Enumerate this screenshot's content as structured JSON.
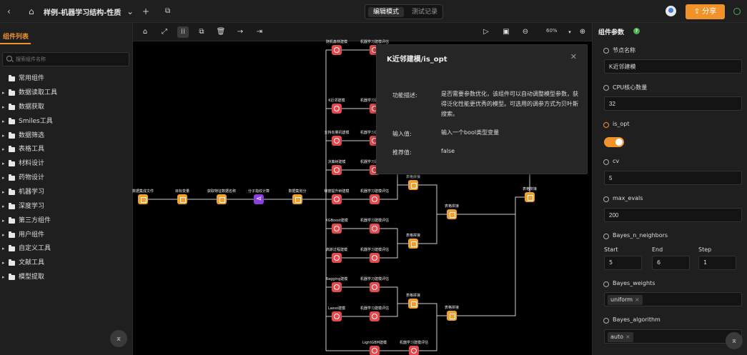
{
  "topbar": {
    "title": "样例-机器学习结构-性质",
    "mode_edit": "编辑模式",
    "mode_test": "测试记录",
    "share": "分享",
    "back_icon": "chevron-left-icon",
    "home_icon": "home-icon",
    "add_icon": "plus-icon",
    "copy_icon": "copy-icon"
  },
  "left": {
    "title": "组件列表",
    "search_placeholder": "搜索组件名称",
    "categories": [
      "常用组件",
      "数据读取工具",
      "数据获取",
      "Smiles工具",
      "数据筛选",
      "表格工具",
      "材料设计",
      "药物设计",
      "机器学习",
      "深度学习",
      "第三方组件",
      "用户组件",
      "自定义工具",
      "文献工具",
      "模型提取"
    ]
  },
  "canvas": {
    "zoom": "60%",
    "nodes": [
      "数据集成文件",
      "目标变量",
      "获取特征数据名称",
      "分子指纹计算",
      "数据集划分",
      "随机森林建模",
      "机器学习建模评估",
      "K近邻建模",
      "机器学习建模评估",
      "支持向量机建模",
      "机器学习建模评估",
      "决策树建模",
      "机器学习建模评估",
      "梯度提升树建模",
      "机器学习建模评估",
      "XGBoost建模",
      "机器学习建模评估",
      "高斯过程建模",
      "机器学习建模评估",
      "Bagging建模",
      "机器学习建模评估",
      "Lasso建模",
      "机器学习建模评估",
      "LightGBM建模",
      "机器学习建模评估",
      "表格拼接",
      "表格拼接",
      "表格拼接",
      "表格拼接",
      "表格拼接",
      "表格拼接",
      "表格拼接",
      "表格拼接"
    ]
  },
  "popup": {
    "title": "K近邻建模/is_opt",
    "desc_label": "功能描述:",
    "desc": "是否需要参数优化，该组件可以自动调整模型参数，获得泛化性能更优秀的模型。可选用的调参方式为贝叶斯搜索。",
    "input_label": "输入值:",
    "input": "输入一个bool类型变量",
    "recommend_label": "推荐值:",
    "recommend": "false"
  },
  "right": {
    "title": "组件参数",
    "help": "?",
    "node_name_label": "节点名称",
    "node_name": "K近邻建模",
    "cpu_label": "CPU核心数量",
    "cpu": "32",
    "isopt_label": "is_opt",
    "cv_label": "cv",
    "cv": "5",
    "max_evals_label": "max_evals",
    "max_evals": "200",
    "bnn_label": "Bayes_n_neighbors",
    "start_label": "Start",
    "end_label": "End",
    "step_label": "Step",
    "start": "5",
    "end": "6",
    "step": "1",
    "bw_label": "Bayes_weights",
    "bw": "uniform",
    "ba_label": "Bayes_algorithm",
    "ba": "auto"
  }
}
